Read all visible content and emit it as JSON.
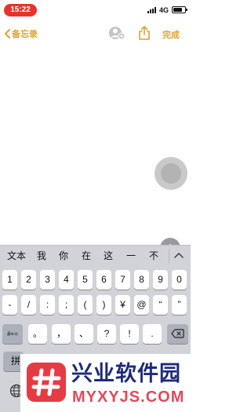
{
  "status_bar": {
    "time": "15:22",
    "network": "4G",
    "battery_level": 0.8
  },
  "nav": {
    "back_label": "备忘录",
    "done_label": "完成"
  },
  "colors": {
    "accent": "#e1a22a",
    "time_pill": "#e5352b",
    "keyboard_bg": "#d1d3d9",
    "key_dark": "#abb0bb"
  },
  "keyboard": {
    "candidates": [
      "文本",
      "我",
      "你",
      "在",
      "这",
      "一",
      "不"
    ],
    "row1": [
      "1",
      "2",
      "3",
      "4",
      "5",
      "6",
      "7",
      "8",
      "9",
      "0"
    ],
    "row2": [
      "-",
      "/",
      ":",
      ";",
      "(",
      ")",
      "¥",
      "@",
      "“",
      "”"
    ],
    "row3_left": "#+=",
    "row3": [
      "。",
      "，",
      "、",
      "?",
      "!",
      "."
    ],
    "row4_left": "拼",
    "icons": {
      "collapse": "chevron-up-icon",
      "delete": "backspace-icon",
      "globe": "globe-icon"
    }
  },
  "watermark": {
    "title": "兴业软件园",
    "url": "MYXYJS.COM"
  },
  "icons": {
    "back": "chevron-left-icon",
    "collab": "add-person-icon",
    "share": "share-icon",
    "assistive": "assistive-touch-icon",
    "add": "plus-icon"
  },
  "fab": {
    "plus": "+"
  }
}
